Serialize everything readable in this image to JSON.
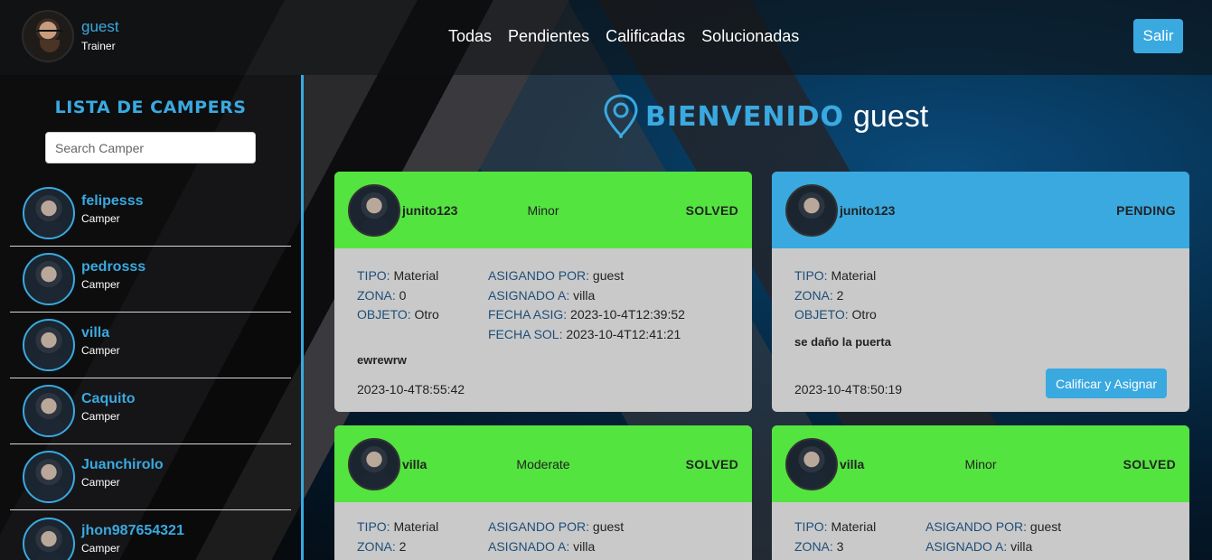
{
  "header": {
    "user_name": "guest",
    "user_role": "Trainer",
    "nav": [
      "Todas",
      "Pendientes",
      "Calificadas",
      "Solucionadas"
    ],
    "logout_label": "Salir"
  },
  "sidebar": {
    "title": "LISTA DE CAMPERS",
    "search_placeholder": "Search Camper",
    "campers": [
      {
        "name": "felipesss",
        "role": "Camper"
      },
      {
        "name": "pedrosss",
        "role": "Camper"
      },
      {
        "name": "villa",
        "role": "Camper"
      },
      {
        "name": "Caquito",
        "role": "Camper"
      },
      {
        "name": "Juanchirolo",
        "role": "Camper"
      },
      {
        "name": "jhon987654321",
        "role": "Camper"
      }
    ]
  },
  "main": {
    "welcome_word": "BIENVENIDO",
    "welcome_user": "guest",
    "labels": {
      "tipo": "TIPO:",
      "zona": "ZONA:",
      "objeto": "OBJETO:",
      "asignado_por": "ASIGANDO POR:",
      "asignado_a": "ASIGNADO A:",
      "fecha_asig": "FECHA ASIG:",
      "fecha_sol": "FECHA SOL:"
    },
    "cards": [
      {
        "user": "junito123",
        "severity": "Minor",
        "status": "SOLVED",
        "tipo": "Material",
        "zona": "0",
        "objeto": "Otro",
        "asignado_por": "guest",
        "asignado_a": "villa",
        "fecha_asig": "2023-10-4T12:39:52",
        "fecha_sol": "2023-10-4T12:41:21",
        "description": "ewrewrw",
        "date": "2023-10-4T8:55:42"
      },
      {
        "user": "junito123",
        "severity": "",
        "status": "PENDING",
        "tipo": "Material",
        "zona": "2",
        "objeto": "Otro",
        "description": "se daño la puerta",
        "date": "2023-10-4T8:50:19",
        "button": "Calificar y Asignar"
      },
      {
        "user": "villa",
        "severity": "Moderate",
        "status": "SOLVED",
        "tipo": "Material",
        "zona": "2",
        "asignado_por": "guest",
        "asignado_a": "villa"
      },
      {
        "user": "villa",
        "severity": "Minor",
        "status": "SOLVED",
        "tipo": "Material",
        "zona": "3",
        "asignado_por": "guest",
        "asignado_a": "villa"
      }
    ]
  },
  "colors": {
    "accent": "#3aa9e0",
    "solved": "#54e440",
    "pending": "#3aa9e0",
    "card_body": "#c9c9c9"
  }
}
